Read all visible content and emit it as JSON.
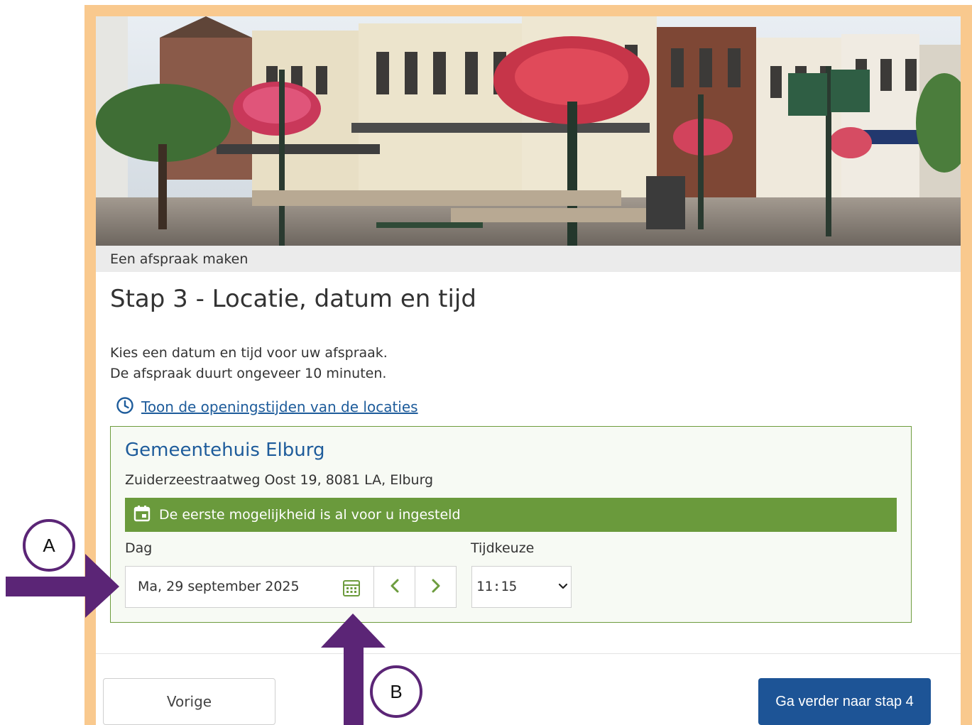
{
  "breadcrumb": "Een afspraak maken",
  "page_title": "Stap 3 - Locatie, datum en tijd",
  "intro": {
    "line1": "Kies een datum en tijd voor uw afspraak.",
    "line2": "De afspraak duurt ongeveer 10 minuten."
  },
  "hours_link": {
    "label": "Toon de openingstijden van de locaties",
    "icon": "clock-icon"
  },
  "location": {
    "name": "Gemeentehuis Elburg",
    "address": "Zuiderzeestraatweg Oost 19, 8081 LA, Elburg",
    "notice": "De eerste mogelijkheid is al voor u ingesteld",
    "notice_icon": "calendar-icon"
  },
  "form": {
    "day_label": "Dag",
    "day_value": "Ma, 29 september 2025",
    "time_label": "Tijdkeuze",
    "time_value": "11:15"
  },
  "buttons": {
    "previous": "Vorige",
    "next": "Ga verder naar stap 4"
  },
  "annotations": {
    "a": "A",
    "b": "B"
  },
  "colors": {
    "frame": "#f9c98e",
    "link": "#1e5c9b",
    "notice_bg": "#6a9a3c",
    "primary_button": "#1d5496",
    "arrow": "#5b2576"
  }
}
